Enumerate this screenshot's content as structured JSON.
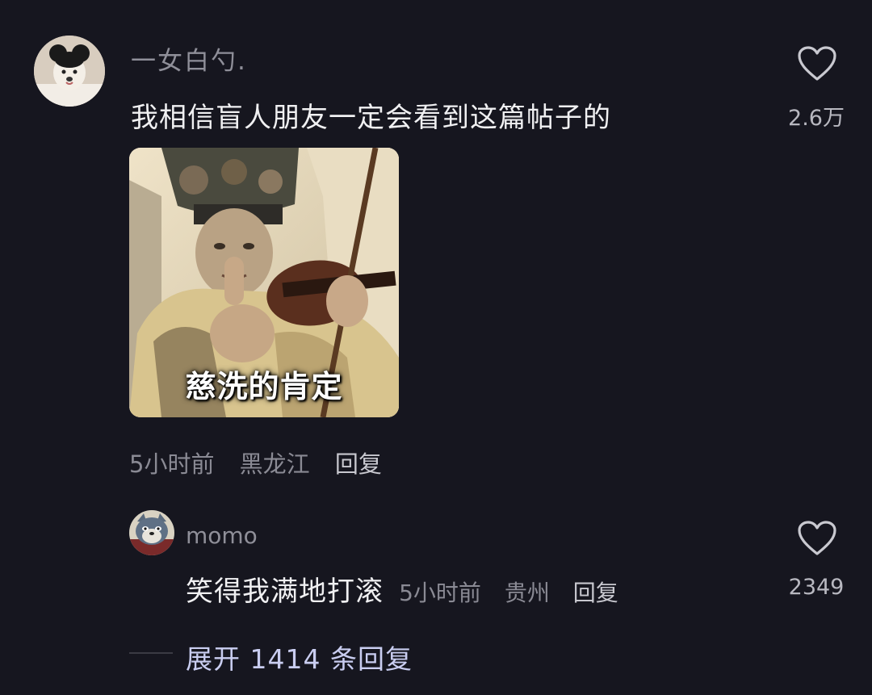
{
  "comment": {
    "username": "一女白勺.",
    "text": "我相信盲人朋友一定会看到这篇帖子的",
    "image_caption": "慈洗的肯定",
    "time": "5小时前",
    "location": "黑龙江",
    "reply_label": "回复",
    "like_count": "2.6万"
  },
  "reply": {
    "username": "momo",
    "text": "笑得我满地打滚",
    "time": "5小时前",
    "location": "贵州",
    "reply_label": "回复",
    "like_count": "2349"
  },
  "expand": {
    "label": "展开 1414 条回复"
  },
  "colors": {
    "background": "#16161f",
    "expand_accent": "#c9cdf0"
  },
  "icons": {
    "like": "heart-outline-icon"
  }
}
